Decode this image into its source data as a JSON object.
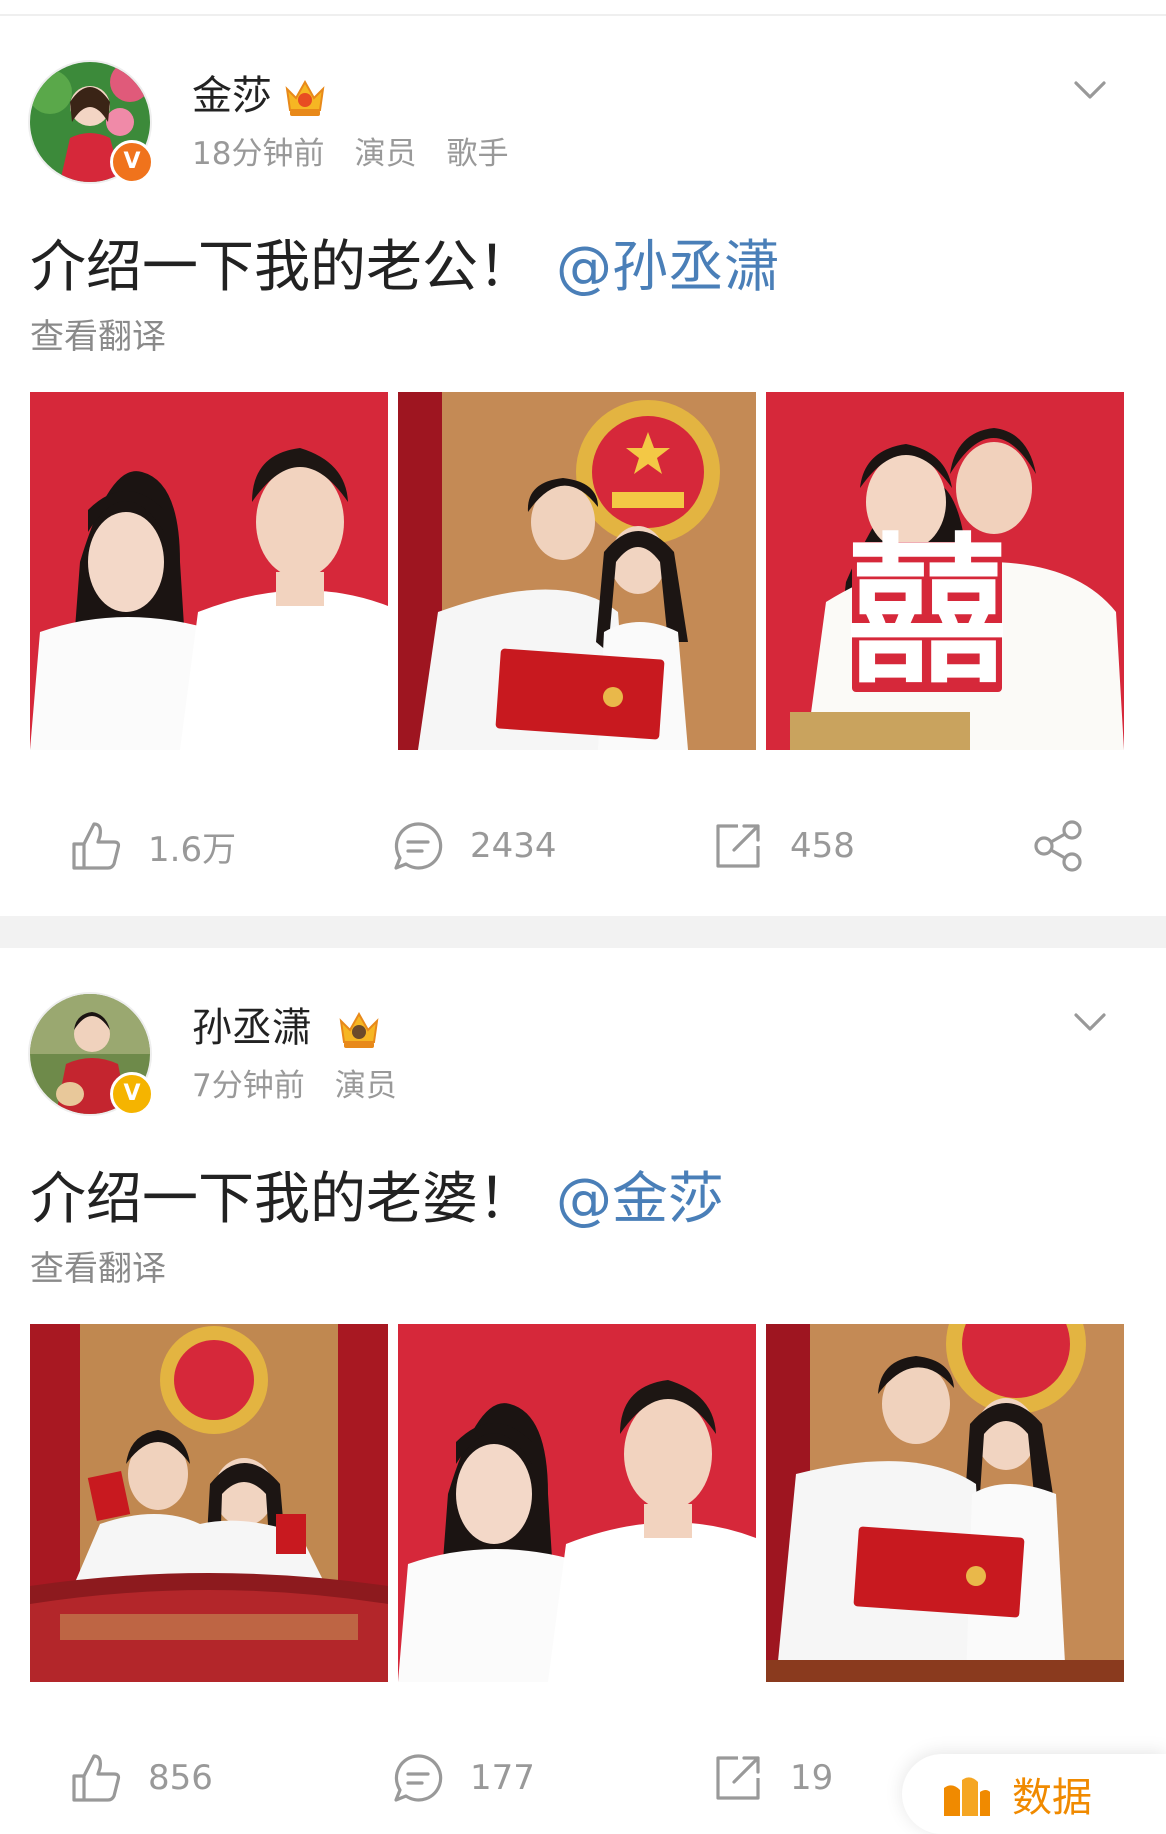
{
  "posts": [
    {
      "username": "金莎",
      "time": "18分钟前",
      "tags": [
        "演员",
        "歌手"
      ],
      "text": "介绍一下我的老公！",
      "mention": "@孙丞潇",
      "translate": "查看翻译",
      "badge_letter": "V",
      "likes": "1.6万",
      "comments": "2434",
      "reposts": "458"
    },
    {
      "username": "孙丞潇",
      "time": "7分钟前",
      "tags": [
        "演员"
      ],
      "text": "介绍一下我的老婆！",
      "mention": "@金莎",
      "translate": "查看翻译",
      "badge_letter": "V",
      "likes": "856",
      "comments": "177",
      "reposts": "19"
    }
  ],
  "photo_stamp_text": "囍",
  "data_button": {
    "label": "数据"
  },
  "colors": {
    "mention": "#4a7fb8",
    "accent_red": "#d6283a",
    "badge_orange": "#f0731c",
    "badge_gold": "#f5b400",
    "data_orange": "#f08a00"
  }
}
